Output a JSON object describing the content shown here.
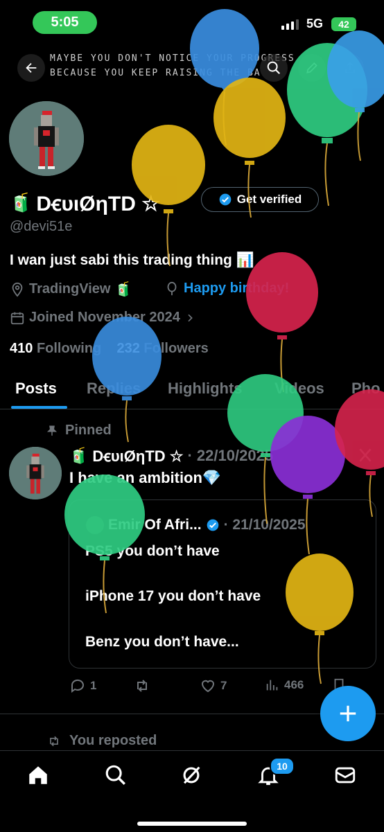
{
  "status": {
    "time": "5:05",
    "network": "5G",
    "battery": "42"
  },
  "banner": {
    "text": "MAYBE YOU DON'T NOTICE YOUR PROGRESS\nBECAUSE YOU KEEP RAISING THE BA"
  },
  "profile": {
    "name": "DꞓυιØηTD ☆",
    "get_verified": "Get verified",
    "handle": "@devi51e",
    "bio": "I wan just sabi this trading thing 📊",
    "website": "TradingView",
    "birthday": "Happy birthday!",
    "joined": "Joined November 2024",
    "following_count": "410",
    "following_label": "Following",
    "followers_count": "232",
    "followers_label": "Followers"
  },
  "tabs": [
    "Posts",
    "Replies",
    "Highlights",
    "Videos",
    "Pho"
  ],
  "post": {
    "pinned_label": "Pinned",
    "author": "DꞓυιØηTD ☆",
    "date": "· 22/10/2025",
    "text": "I have an ambition💎",
    "quote": {
      "author": "Emir Of Afri...",
      "date": "· 21/10/2025",
      "line1": "PS5 you don’t have",
      "line2": "iPhone 17 you don’t have",
      "line3": "Benz you don’t have..."
    },
    "replies": "1",
    "reposts": "",
    "likes": "7",
    "views": "466"
  },
  "reposted_label": "You reposted",
  "notifications_badge": "10",
  "colors": {
    "accent": "#1d9bf0",
    "background": "#000000",
    "status_pill": "#34c759"
  }
}
